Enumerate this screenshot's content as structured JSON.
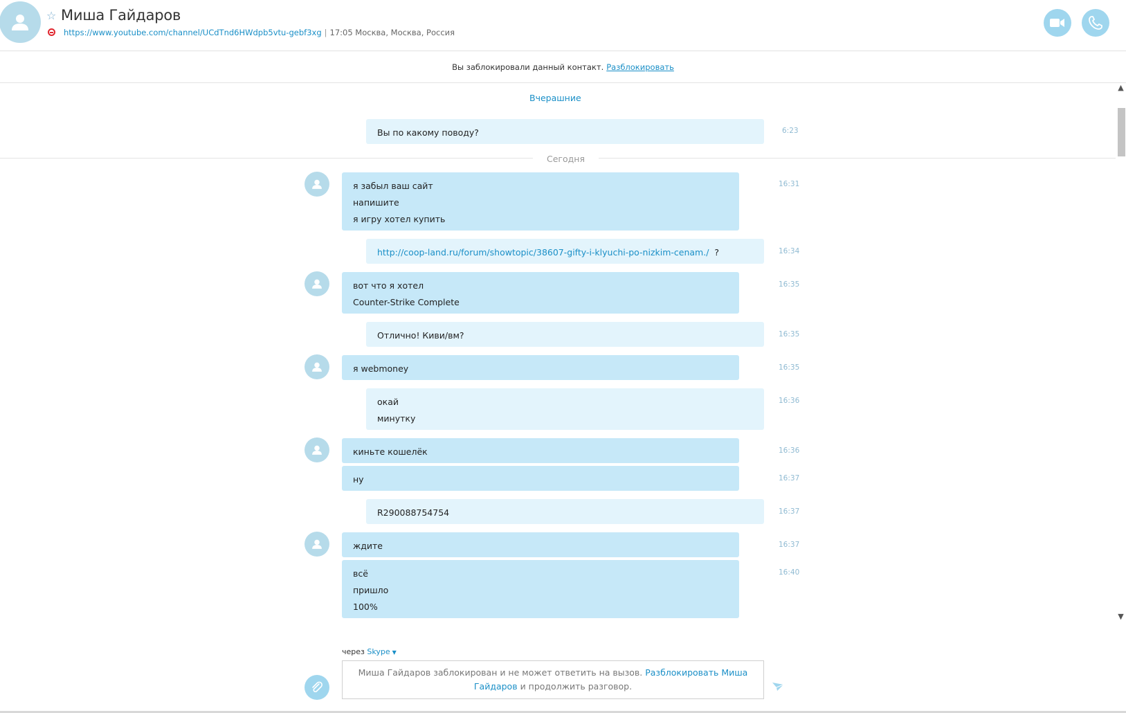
{
  "header": {
    "name": "Миша Гайдаров",
    "url": "https://www.youtube.com/channel/UCdTnd6HWdpb5vtu-gebf3xg",
    "separator": "|",
    "local_time_location": "17:05 Москва, Москва, Россия"
  },
  "banner": {
    "text": "Вы заблокировали данный контакт.",
    "unblock_link": "Разблокировать"
  },
  "days": {
    "yesterday": "Вчерашние",
    "today": "Сегодня"
  },
  "messages": [
    {
      "dir": "out",
      "lines": [
        "Вы по какому поводу?"
      ],
      "time": "6:23"
    },
    {
      "dir": "in",
      "lines": [
        "я забыл ваш сайт",
        "напишите",
        "я игру хотел купить"
      ],
      "time": "16:31"
    },
    {
      "dir": "out",
      "link": "http://coop-land.ru/forum/showtopic/38607-gifty-i-klyuchi-po-nizkim-cenam./",
      "suffix": "?",
      "time": "16:34"
    },
    {
      "dir": "in",
      "lines": [
        "вот что я хотел",
        "Counter-Strike Complete"
      ],
      "time": "16:35"
    },
    {
      "dir": "out",
      "lines": [
        "Отлично! Киви/вм?"
      ],
      "time": "16:35"
    },
    {
      "dir": "in",
      "lines": [
        "я webmoney"
      ],
      "time": "16:35"
    },
    {
      "dir": "out",
      "lines": [
        "окай",
        "минутку"
      ],
      "time": "16:36"
    },
    {
      "dir": "in",
      "lines": [
        "киньте кошелёк"
      ],
      "time": "16:36"
    },
    {
      "dir": "in",
      "lines": [
        "ну"
      ],
      "time": "16:37"
    },
    {
      "dir": "out",
      "lines": [
        "R290088754754"
      ],
      "time": "16:37"
    },
    {
      "dir": "in",
      "lines": [
        "ждите"
      ],
      "time": "16:37"
    },
    {
      "dir": "in",
      "lines": [
        "всё",
        "пришло",
        "100%"
      ],
      "time": "16:40"
    }
  ],
  "footer": {
    "via_label": "через",
    "via_service": "Skype",
    "compose_text_1": "Миша Гайдаров заблокирован и не может ответить на вызов.",
    "compose_link_1": "Разблокировать Миша",
    "compose_link_2": "Гайдаров",
    "compose_text_2": "и продолжить разговор."
  },
  "icons": {
    "avatar": "person-icon",
    "video_call": "video-camera-icon",
    "audio_call": "phone-icon",
    "attach": "paperclip-icon",
    "send": "send-icon",
    "favorite": "star-icon",
    "blocked": "blocked-status-icon"
  },
  "colors": {
    "accent": "#1a8fc7",
    "incoming_bubble": "#c6e8f8",
    "outgoing_bubble": "#e3f4fc",
    "avatar_bg": "#b6dbea",
    "blocked_red": "#e0262f"
  }
}
